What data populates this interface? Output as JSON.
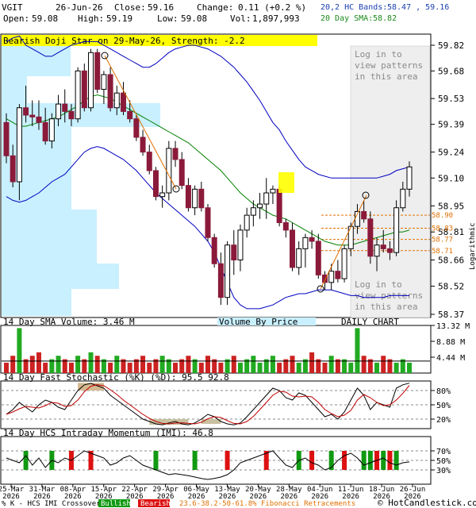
{
  "header": {
    "ticker": "VGIT",
    "date": "26-Jun-26",
    "close_label": "Close:",
    "close": "59.16",
    "change_label": "Change:",
    "change": "0.11 (+0.2 %)",
    "open_label": "Open:",
    "open": "59.08",
    "high_label": "High:",
    "high": "59.19",
    "low_label": "Low:",
    "low": "59.08",
    "vol_label": "Vol:",
    "vol": "1,897,993",
    "bands_label": "20,2 HC Bands:",
    "bands": "58.47 , 59.16",
    "sma_label": "20 Day SMA:",
    "sma": "58.82"
  },
  "pattern_banner": "Bearish Doji Star on 29-May-26, Strength: -2.2",
  "login_text": [
    "Log in to",
    "view patterns",
    "in this area"
  ],
  "panel_labels": {
    "volume_sma": "14 Day SMA Volume: 3.46 M",
    "volume_by_price": "Volume By Price",
    "daily_chart": "DAILY CHART",
    "stochastic": "14 Day Fast Stochastic (%K) (%D): 95.5  92.8",
    "momentum": "14 Day HCS Intraday Momentum (IMI): 46.8",
    "log_axis": "Logarithmic"
  },
  "footer": {
    "crossover": "% K - HCS IMI Crossover:",
    "bullish": "Bullish",
    "bearish": "Bearish",
    "fib": "23.6-38.2-50-61.8% Fibonacci Retracements",
    "copyright": "© HotCandlestick.com"
  },
  "colors": {
    "bull": "#ffffff",
    "bear": "#8b1a3a",
    "band": "#0000c0",
    "sma": "#008000",
    "vbp": "#c8f0ff",
    "fib": "#e07000",
    "volume": "#22aa22",
    "volume_down": "#cc2222",
    "banner": "#ffff00",
    "stoch_fill_hi": "#d4b890",
    "stoch_fill_lo": "#c8c0a0"
  },
  "chart_data": {
    "type": "candlestick",
    "price_axis": {
      "scale": "log",
      "ylim": [
        58.37,
        59.82
      ],
      "ticks": [
        "59.82",
        "59.68",
        "59.53",
        "59.39",
        "59.24",
        "59.10",
        "58.95",
        "58.81",
        "58.66",
        "58.52",
        "58.37"
      ]
    },
    "fib_levels": [
      "58.90",
      "58.83",
      "58.77",
      "58.71"
    ],
    "x_ticks": [
      {
        "top": "25-Mar",
        "bottom": "2026"
      },
      {
        "top": "31-Mar",
        "bottom": "2026"
      },
      {
        "top": "08-Apr",
        "bottom": "2026"
      },
      {
        "top": "15-Apr",
        "bottom": "2026"
      },
      {
        "top": "22-Apr",
        "bottom": "2026"
      },
      {
        "top": "29-Apr",
        "bottom": "2026"
      },
      {
        "top": "06-May",
        "bottom": "2026"
      },
      {
        "top": "13-May",
        "bottom": "2026"
      },
      {
        "top": "20-May",
        "bottom": "2026"
      },
      {
        "top": "28-May",
        "bottom": "2026"
      },
      {
        "top": "04-Jun",
        "bottom": "2026"
      },
      {
        "top": "11-Jun",
        "bottom": "2026"
      },
      {
        "top": "18-Jun",
        "bottom": "2026"
      },
      {
        "top": "26-Jun",
        "bottom": "2026"
      }
    ],
    "candles": [
      [
        59.4,
        59.45,
        59.18,
        59.22
      ],
      [
        59.22,
        59.28,
        59.05,
        59.08
      ],
      [
        59.08,
        59.5,
        58.98,
        59.48
      ],
      [
        59.48,
        59.6,
        59.4,
        59.44
      ],
      [
        59.44,
        59.52,
        59.38,
        59.43
      ],
      [
        59.43,
        59.52,
        59.36,
        59.4
      ],
      [
        59.4,
        59.48,
        59.28,
        59.3
      ],
      [
        59.3,
        59.45,
        59.26,
        59.42
      ],
      [
        59.42,
        59.55,
        59.38,
        59.5
      ],
      [
        59.5,
        59.58,
        59.4,
        59.46
      ],
      [
        59.46,
        59.5,
        59.38,
        59.42
      ],
      [
        59.42,
        59.7,
        59.4,
        59.68
      ],
      [
        59.68,
        59.72,
        59.46,
        59.48
      ],
      [
        59.48,
        59.8,
        59.46,
        59.78
      ],
      [
        59.78,
        59.8,
        59.56,
        59.58
      ],
      [
        59.58,
        59.68,
        59.5,
        59.66
      ],
      [
        59.66,
        59.7,
        59.46,
        59.48
      ],
      [
        59.48,
        59.6,
        59.44,
        59.56
      ],
      [
        59.56,
        59.62,
        59.44,
        59.46
      ],
      [
        59.46,
        59.52,
        59.4,
        59.42
      ],
      [
        59.42,
        59.44,
        59.3,
        59.32
      ],
      [
        59.32,
        59.36,
        59.22,
        59.24
      ],
      [
        59.24,
        59.28,
        59.12,
        59.14
      ],
      [
        59.14,
        59.16,
        58.98,
        59.0
      ],
      [
        59.0,
        59.06,
        58.94,
        59.02
      ],
      [
        59.02,
        59.3,
        58.98,
        59.26
      ],
      [
        59.26,
        59.3,
        59.16,
        59.2
      ],
      [
        59.2,
        59.24,
        59.04,
        59.06
      ],
      [
        59.06,
        59.1,
        58.92,
        58.94
      ],
      [
        58.94,
        59.06,
        58.9,
        59.04
      ],
      [
        59.04,
        59.08,
        58.92,
        58.94
      ],
      [
        58.94,
        58.96,
        58.76,
        58.78
      ],
      [
        58.78,
        58.8,
        58.62,
        58.64
      ],
      [
        58.64,
        58.7,
        58.42,
        58.46
      ],
      [
        58.46,
        58.76,
        58.42,
        58.74
      ],
      [
        58.74,
        58.82,
        58.58,
        58.66
      ],
      [
        58.66,
        58.85,
        58.6,
        58.82
      ],
      [
        58.82,
        58.94,
        58.78,
        58.9
      ],
      [
        58.9,
        58.98,
        58.84,
        58.94
      ],
      [
        58.94,
        59.02,
        58.88,
        58.96
      ],
      [
        58.96,
        59.1,
        58.88,
        59.02
      ],
      [
        59.02,
        59.06,
        58.96,
        59.04
      ],
      [
        59.04,
        59.06,
        58.84,
        58.86
      ],
      [
        58.86,
        58.88,
        58.78,
        58.82
      ],
      [
        58.82,
        58.86,
        58.6,
        58.62
      ],
      [
        58.62,
        58.76,
        58.58,
        58.72
      ],
      [
        58.72,
        58.8,
        58.62,
        58.78
      ],
      [
        58.78,
        58.82,
        58.72,
        58.76
      ],
      [
        58.76,
        58.8,
        58.56,
        58.58
      ],
      [
        58.58,
        58.6,
        58.5,
        58.54
      ],
      [
        58.54,
        58.64,
        58.5,
        58.6
      ],
      [
        58.6,
        58.66,
        58.54,
        58.56
      ],
      [
        58.56,
        58.74,
        58.54,
        58.72
      ],
      [
        58.72,
        58.86,
        58.68,
        58.84
      ],
      [
        58.84,
        58.96,
        58.8,
        58.92
      ],
      [
        58.92,
        58.98,
        58.86,
        58.88
      ],
      [
        58.88,
        58.92,
        58.64,
        58.68
      ],
      [
        58.68,
        58.78,
        58.6,
        58.74
      ],
      [
        58.74,
        58.82,
        58.7,
        58.72
      ],
      [
        58.72,
        58.76,
        58.66,
        58.7
      ],
      [
        58.7,
        58.98,
        58.68,
        58.94
      ],
      [
        58.94,
        59.08,
        58.92,
        59.04
      ],
      [
        59.04,
        59.19,
        59.0,
        59.16
      ]
    ],
    "band_upper": [
      59.84,
      59.86,
      59.88,
      59.82,
      59.8,
      59.78,
      59.76,
      59.76,
      59.78,
      59.8,
      59.82,
      59.83,
      59.84,
      59.84,
      59.84,
      59.82,
      59.8,
      59.78,
      59.76,
      59.74,
      59.72,
      59.7,
      59.7,
      59.72,
      59.75,
      59.78,
      59.8,
      59.81,
      59.82,
      59.82,
      59.81,
      59.8,
      59.78,
      59.76,
      59.73,
      59.7,
      59.66,
      59.62,
      59.57,
      59.52,
      59.46,
      59.4,
      59.36,
      59.3,
      59.25,
      59.2,
      59.16,
      59.14,
      59.12,
      59.11,
      59.1,
      59.1,
      59.1,
      59.1,
      59.1,
      59.1,
      59.1,
      59.1,
      59.11,
      59.12,
      59.14,
      59.15,
      59.16
    ],
    "band_lower": [
      59.0,
      58.98,
      58.97,
      58.98,
      59.0,
      59.02,
      59.05,
      59.08,
      59.1,
      59.12,
      59.16,
      59.2,
      59.24,
      59.26,
      59.27,
      59.26,
      59.24,
      59.22,
      59.2,
      59.17,
      59.14,
      59.1,
      59.06,
      59.02,
      58.99,
      58.96,
      58.93,
      58.9,
      58.87,
      58.84,
      58.8,
      58.76,
      58.7,
      58.62,
      58.54,
      58.46,
      58.42,
      58.4,
      58.4,
      58.4,
      58.41,
      58.42,
      58.44,
      58.46,
      58.47,
      58.48,
      58.48,
      58.49,
      58.5,
      58.5,
      58.5,
      58.49,
      58.48,
      58.47,
      58.47,
      58.46,
      58.46,
      58.46,
      58.46,
      58.47,
      58.47,
      58.47,
      58.47
    ],
    "sma20": [
      59.42,
      59.4,
      59.38,
      59.38,
      59.39,
      59.4,
      59.41,
      59.42,
      59.43,
      59.45,
      59.47,
      59.49,
      59.52,
      59.54,
      59.55,
      59.54,
      59.53,
      59.51,
      59.49,
      59.47,
      59.45,
      59.43,
      59.41,
      59.39,
      59.37,
      59.35,
      59.33,
      59.31,
      59.29,
      59.26,
      59.23,
      59.2,
      59.17,
      59.14,
      59.1,
      59.06,
      59.02,
      58.99,
      58.96,
      58.94,
      58.92,
      58.9,
      58.89,
      58.88,
      58.86,
      58.84,
      58.82,
      58.8,
      58.78,
      58.76,
      58.75,
      58.74,
      58.74,
      58.74,
      58.75,
      58.76,
      58.77,
      58.78,
      58.79,
      58.8,
      58.81,
      58.81,
      58.82
    ],
    "volume": {
      "ticks": [
        "13.32 M",
        "8.88 M",
        "4.44 M"
      ],
      "ylim": [
        0,
        13.32
      ]
    },
    "stochastic": {
      "ticks": [
        "80%",
        "50%",
        "20%"
      ],
      "ylim": [
        0,
        100
      ],
      "k": 95.5,
      "d": 92.8
    },
    "imi": {
      "ticks": [
        "70%",
        "50%",
        "30%"
      ],
      "ylim": [
        0,
        100
      ],
      "value": 46.8
    }
  }
}
